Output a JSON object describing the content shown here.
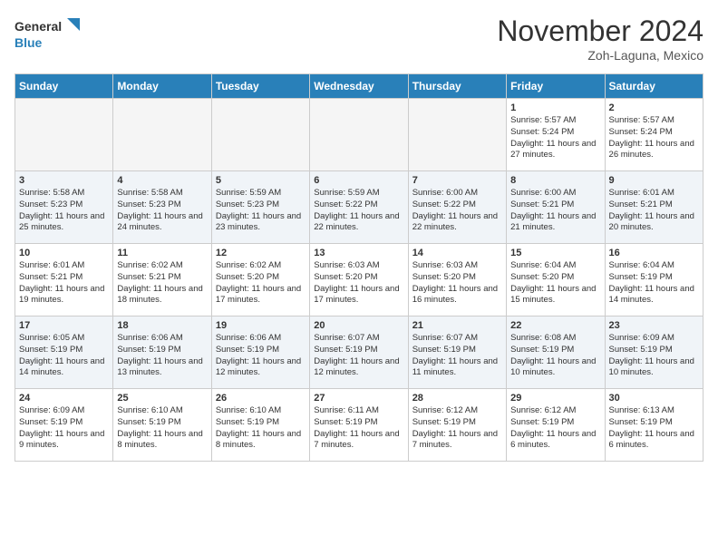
{
  "header": {
    "logo_general": "General",
    "logo_blue": "Blue",
    "month": "November 2024",
    "location": "Zoh-Laguna, Mexico"
  },
  "weekdays": [
    "Sunday",
    "Monday",
    "Tuesday",
    "Wednesday",
    "Thursday",
    "Friday",
    "Saturday"
  ],
  "rows": [
    {
      "cells": [
        {
          "empty": true
        },
        {
          "empty": true
        },
        {
          "empty": true
        },
        {
          "empty": true
        },
        {
          "empty": true
        },
        {
          "day": "1",
          "info": "Sunrise: 5:57 AM\nSunset: 5:24 PM\nDaylight: 11 hours and 27 minutes."
        },
        {
          "day": "2",
          "info": "Sunrise: 5:57 AM\nSunset: 5:24 PM\nDaylight: 11 hours and 26 minutes."
        }
      ]
    },
    {
      "cells": [
        {
          "day": "3",
          "info": "Sunrise: 5:58 AM\nSunset: 5:23 PM\nDaylight: 11 hours and 25 minutes."
        },
        {
          "day": "4",
          "info": "Sunrise: 5:58 AM\nSunset: 5:23 PM\nDaylight: 11 hours and 24 minutes."
        },
        {
          "day": "5",
          "info": "Sunrise: 5:59 AM\nSunset: 5:23 PM\nDaylight: 11 hours and 23 minutes."
        },
        {
          "day": "6",
          "info": "Sunrise: 5:59 AM\nSunset: 5:22 PM\nDaylight: 11 hours and 22 minutes."
        },
        {
          "day": "7",
          "info": "Sunrise: 6:00 AM\nSunset: 5:22 PM\nDaylight: 11 hours and 22 minutes."
        },
        {
          "day": "8",
          "info": "Sunrise: 6:00 AM\nSunset: 5:21 PM\nDaylight: 11 hours and 21 minutes."
        },
        {
          "day": "9",
          "info": "Sunrise: 6:01 AM\nSunset: 5:21 PM\nDaylight: 11 hours and 20 minutes."
        }
      ]
    },
    {
      "cells": [
        {
          "day": "10",
          "info": "Sunrise: 6:01 AM\nSunset: 5:21 PM\nDaylight: 11 hours and 19 minutes."
        },
        {
          "day": "11",
          "info": "Sunrise: 6:02 AM\nSunset: 5:21 PM\nDaylight: 11 hours and 18 minutes."
        },
        {
          "day": "12",
          "info": "Sunrise: 6:02 AM\nSunset: 5:20 PM\nDaylight: 11 hours and 17 minutes."
        },
        {
          "day": "13",
          "info": "Sunrise: 6:03 AM\nSunset: 5:20 PM\nDaylight: 11 hours and 17 minutes."
        },
        {
          "day": "14",
          "info": "Sunrise: 6:03 AM\nSunset: 5:20 PM\nDaylight: 11 hours and 16 minutes."
        },
        {
          "day": "15",
          "info": "Sunrise: 6:04 AM\nSunset: 5:20 PM\nDaylight: 11 hours and 15 minutes."
        },
        {
          "day": "16",
          "info": "Sunrise: 6:04 AM\nSunset: 5:19 PM\nDaylight: 11 hours and 14 minutes."
        }
      ]
    },
    {
      "cells": [
        {
          "day": "17",
          "info": "Sunrise: 6:05 AM\nSunset: 5:19 PM\nDaylight: 11 hours and 14 minutes."
        },
        {
          "day": "18",
          "info": "Sunrise: 6:06 AM\nSunset: 5:19 PM\nDaylight: 11 hours and 13 minutes."
        },
        {
          "day": "19",
          "info": "Sunrise: 6:06 AM\nSunset: 5:19 PM\nDaylight: 11 hours and 12 minutes."
        },
        {
          "day": "20",
          "info": "Sunrise: 6:07 AM\nSunset: 5:19 PM\nDaylight: 11 hours and 12 minutes."
        },
        {
          "day": "21",
          "info": "Sunrise: 6:07 AM\nSunset: 5:19 PM\nDaylight: 11 hours and 11 minutes."
        },
        {
          "day": "22",
          "info": "Sunrise: 6:08 AM\nSunset: 5:19 PM\nDaylight: 11 hours and 10 minutes."
        },
        {
          "day": "23",
          "info": "Sunrise: 6:09 AM\nSunset: 5:19 PM\nDaylight: 11 hours and 10 minutes."
        }
      ]
    },
    {
      "cells": [
        {
          "day": "24",
          "info": "Sunrise: 6:09 AM\nSunset: 5:19 PM\nDaylight: 11 hours and 9 minutes."
        },
        {
          "day": "25",
          "info": "Sunrise: 6:10 AM\nSunset: 5:19 PM\nDaylight: 11 hours and 8 minutes."
        },
        {
          "day": "26",
          "info": "Sunrise: 6:10 AM\nSunset: 5:19 PM\nDaylight: 11 hours and 8 minutes."
        },
        {
          "day": "27",
          "info": "Sunrise: 6:11 AM\nSunset: 5:19 PM\nDaylight: 11 hours and 7 minutes."
        },
        {
          "day": "28",
          "info": "Sunrise: 6:12 AM\nSunset: 5:19 PM\nDaylight: 11 hours and 7 minutes."
        },
        {
          "day": "29",
          "info": "Sunrise: 6:12 AM\nSunset: 5:19 PM\nDaylight: 11 hours and 6 minutes."
        },
        {
          "day": "30",
          "info": "Sunrise: 6:13 AM\nSunset: 5:19 PM\nDaylight: 11 hours and 6 minutes."
        }
      ]
    }
  ]
}
